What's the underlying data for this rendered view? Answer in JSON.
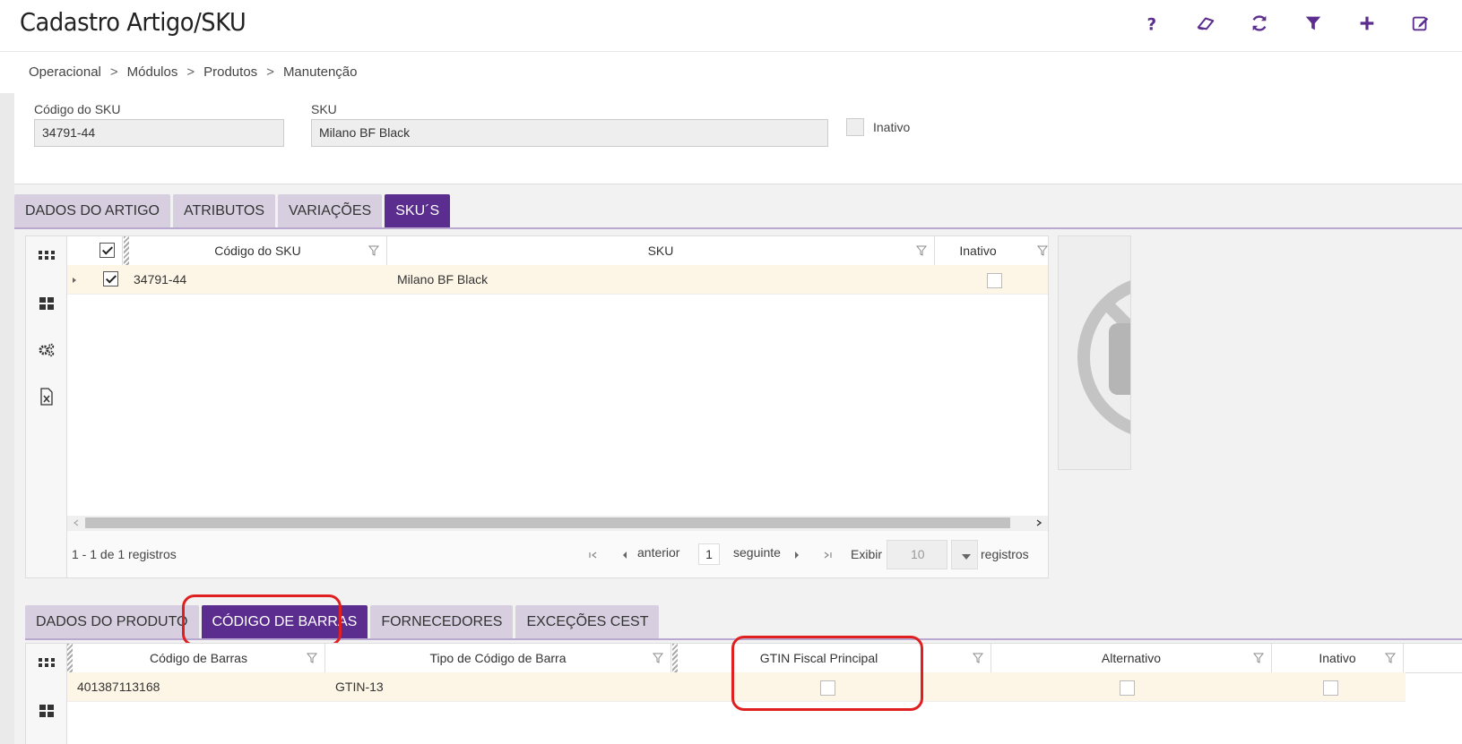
{
  "header": {
    "title": "Cadastro Artigo/SKU"
  },
  "toolbar": [
    {
      "name": "help-button",
      "icon": "question-icon"
    },
    {
      "name": "clear-button",
      "icon": "eraser-icon"
    },
    {
      "name": "refresh-button",
      "icon": "refresh-icon"
    },
    {
      "name": "filter-button",
      "icon": "filter-icon"
    },
    {
      "name": "add-button",
      "icon": "plus-icon"
    },
    {
      "name": "edit-button",
      "icon": "edit-icon"
    }
  ],
  "breadcrumb": [
    "Operacional",
    "Módulos",
    "Produtos",
    "Manutenção"
  ],
  "breadcrumb_sep": ">",
  "form": {
    "sku_code_label": "Código do SKU",
    "sku_code_value": "34791-44",
    "sku_label": "SKU",
    "sku_value": "Milano BF Black",
    "inactive_label": "Inativo"
  },
  "main_tabs": [
    "DADOS DO ARTIGO",
    "ATRIBUTOS",
    "VARIAÇÕES",
    "SKU´S"
  ],
  "main_tab_active": 3,
  "sku_grid": {
    "columns": [
      "Código do SKU",
      "SKU",
      "Inativo"
    ],
    "rows": [
      {
        "code": "34791-44",
        "sku": "Milano BF Black",
        "inactive": false,
        "selected": true
      }
    ],
    "summary": "1 - 1 de 1 registros",
    "prev_label": "anterior",
    "page": "1",
    "next_label": "seguinte",
    "show_label": "Exibir",
    "page_size": "10",
    "records_label": "registros"
  },
  "sub_tabs": [
    "DADOS DO PRODUTO",
    "CÓDIGO DE BARRAS",
    "FORNECEDORES",
    "EXCEÇÕES CEST"
  ],
  "sub_tab_active": 1,
  "barcode_grid": {
    "columns": [
      "Código de Barras",
      "Tipo de Código de Barra",
      "GTIN Fiscal Principal",
      "Alternativo",
      "Inativo"
    ],
    "rows": [
      {
        "barcode": "401387113168",
        "type": "GTIN-13",
        "gtin_main": false,
        "alternative": false,
        "inactive": false
      }
    ]
  },
  "colors": {
    "accent": "#5b2d8e",
    "tab_inactive": "#d7cfe0",
    "row_highlight": "#fdf6e6",
    "annotation": "#e02020"
  }
}
